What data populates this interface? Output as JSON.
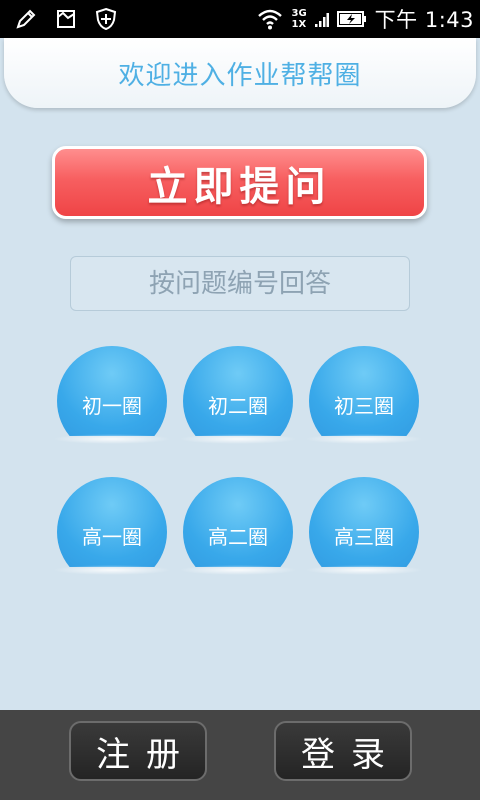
{
  "status_bar": {
    "network_top": "3G",
    "network_bottom": "1X",
    "time": "下午 1:43",
    "icons": [
      "pencil-icon",
      "image-icon",
      "shield-plus-icon",
      "wifi-icon",
      "signal-icon",
      "battery-charging-icon"
    ]
  },
  "header": {
    "title": "欢迎进入作业帮帮圈"
  },
  "ask_button": {
    "label": "立即提问"
  },
  "answer_input": {
    "placeholder": "按问题编号回答",
    "value": ""
  },
  "circles": [
    {
      "label": "初一圈"
    },
    {
      "label": "初二圈"
    },
    {
      "label": "初三圈"
    },
    {
      "label": "高一圈"
    },
    {
      "label": "高二圈"
    },
    {
      "label": "高三圈"
    }
  ],
  "bottom": {
    "register_label": "注册",
    "login_label": "登录"
  },
  "colors": {
    "background": "#d3e3ee",
    "accent_blue": "#4fb0e4",
    "ask_red": "#f75f60",
    "circle_blue": "#38a8ea",
    "bottom_bar": "#454545"
  }
}
